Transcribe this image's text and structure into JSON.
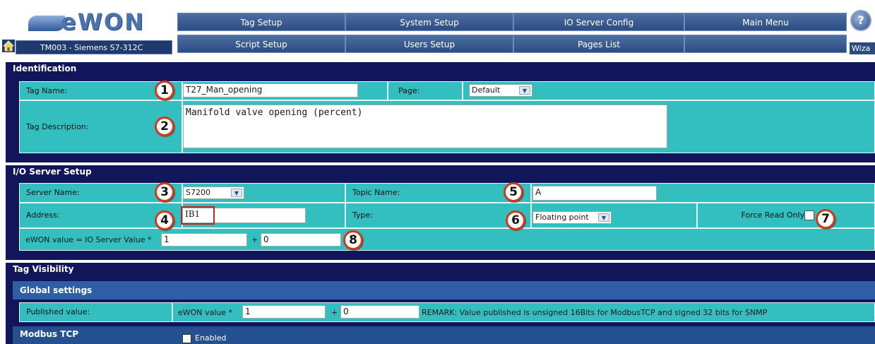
{
  "brand": {
    "logo_text": "eWON"
  },
  "device": {
    "name": "TM003 - Siemens S7-312C"
  },
  "nav": {
    "row1": [
      "Tag Setup",
      "System Setup",
      "IO Server Config",
      "Main Menu"
    ],
    "row2": [
      "Script Setup",
      "Users Setup",
      "Pages List",
      ""
    ],
    "wizard_label": "Wiza"
  },
  "identification": {
    "title": "Identification",
    "tag_name_label": "Tag Name:",
    "tag_name_value": "T27_Man_opening",
    "page_label": "Page:",
    "page_value": "Default",
    "tag_description_label": "Tag Description:",
    "tag_description_value": "Manifold valve opening (percent)"
  },
  "io_server": {
    "title": "I/O Server Setup",
    "server_name_label": "Server Name:",
    "server_name_value": "S7200",
    "topic_name_label": "Topic Name:",
    "topic_name_value": "A",
    "address_label": "Address:",
    "address_value": "IB1",
    "type_label": "Type:",
    "type_value": "Floating point",
    "force_read_only_label": "Force Read Only:",
    "scale_label": "eWON value = IO Server Value *",
    "scale_value": "1",
    "offset_sign": "+",
    "offset_value": "0"
  },
  "visibility": {
    "title": "Tag Visibility",
    "global_settings": "Global settings",
    "published_label": "Published value:",
    "published_scale_label": "eWON value *",
    "published_scale_value": "1",
    "published_offset_sign": "+",
    "published_offset_value": "0",
    "remark": "REMARK: Value published is unsigned 16Bits for ModbusTCP and signed 32 bits for SNMP",
    "modbus_label": "Modbus TCP",
    "modbus_enabled_label": "Enabled"
  },
  "callouts": [
    "1",
    "2",
    "3",
    "4",
    "5",
    "6",
    "7",
    "8"
  ]
}
